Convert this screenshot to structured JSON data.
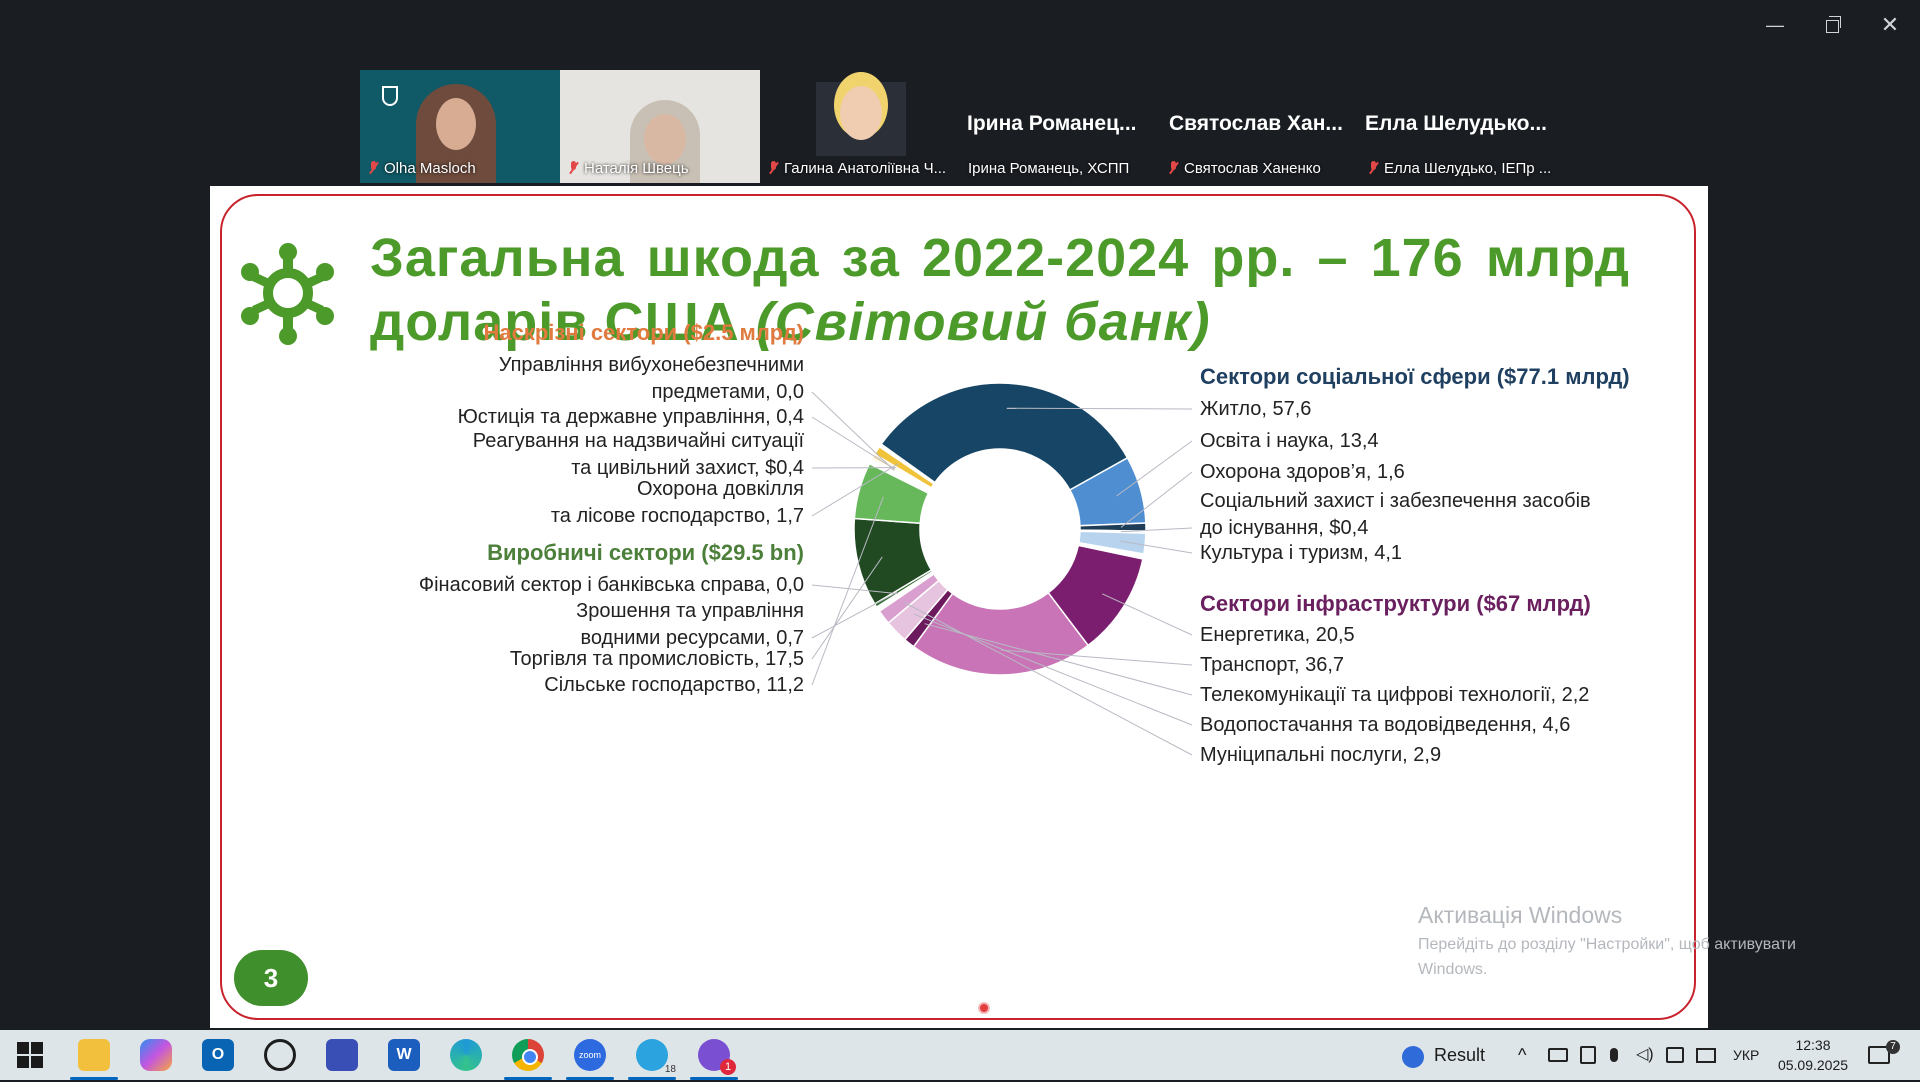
{
  "window": {
    "minimize": "—",
    "restore": "",
    "close": "✕"
  },
  "participants": [
    {
      "name": "Olha Masloch",
      "muted": true
    },
    {
      "name": "Наталія Швець",
      "muted": true
    },
    {
      "name": "Галина Анатоліївна Ч...",
      "muted": true
    },
    {
      "display": "Ірина Романец...",
      "name": "Ірина Романець, ХСПП",
      "muted": false
    },
    {
      "display": "Святослав Хан...",
      "name": "Святослав Ханенко",
      "muted": true
    },
    {
      "display": "Елла Шелудько...",
      "name": "Елла Шелудько, ІЕПр ...",
      "muted": true
    }
  ],
  "slide": {
    "title_line1": "Загальна шкода за 2022-2024 рр. – 176 млрд",
    "title_line2_plain": "доларів США ",
    "title_line2_italic": "(Світовий банк)",
    "page_number": "3",
    "colors": {
      "title": "#4c9a2a",
      "frame": "#c8232c",
      "cross": "#e07a3f",
      "productive": "#4c7f3a",
      "social": "#1f4060",
      "infra": "#6a1f5f"
    }
  },
  "chart_data": {
    "type": "pie",
    "title": "Загальна шкода за 2022-2024 рр. – 176 млрд доларів США (Світовий банк)",
    "groups": [
      {
        "name": "Наскрізні сектори ($2.5 млрд)",
        "items": [
          {
            "label_lines": [
              "Управління вибухонебезпечними",
              "предметами, 0,0"
            ],
            "value": 0.0
          },
          {
            "label_lines": [
              "Юстиція та державне управління, 0,4"
            ],
            "value": 0.4
          },
          {
            "label_lines": [
              "Реагування на надзвичайні ситуації",
              "та цивільний захист, $0,4"
            ],
            "value": 0.4
          },
          {
            "label_lines": [
              "Охорона довкілля",
              "та лісове господарство, 1,7"
            ],
            "value": 1.7
          }
        ]
      },
      {
        "name": "Виробничі сектори ($29.5 bn)",
        "items": [
          {
            "label_lines": [
              "Фінасовий сектор і банківська справа, 0,0"
            ],
            "value": 0.0
          },
          {
            "label_lines": [
              "Зрошення та управління",
              "водними ресурсами, 0,7"
            ],
            "value": 0.7
          },
          {
            "label_lines": [
              "Торгівля та промисловість, 17,5"
            ],
            "value": 17.5
          },
          {
            "label_lines": [
              "Сільське господарство, 11,2"
            ],
            "value": 11.2
          }
        ]
      },
      {
        "name": "Сектори соціальної сфери ($77.1 млрд)",
        "items": [
          {
            "label_lines": [
              "Житло, 57,6"
            ],
            "value": 57.6
          },
          {
            "label_lines": [
              "Освіта і наука, 13,4"
            ],
            "value": 13.4
          },
          {
            "label_lines": [
              "Охорона здоров’я, 1,6"
            ],
            "value": 1.6
          },
          {
            "label_lines": [
              "Соціальний захист і забезпечення засобів",
              "до існування, $0,4"
            ],
            "value": 0.4
          },
          {
            "label_lines": [
              "Культура і туризм, 4,1"
            ],
            "value": 4.1
          }
        ]
      },
      {
        "name": "Сектори інфраструктури  ($67 млрд)",
        "items": [
          {
            "label_lines": [
              "Енергетика, 20,5"
            ],
            "value": 20.5
          },
          {
            "label_lines": [
              "Транспорт, 36,7"
            ],
            "value": 36.7
          },
          {
            "label_lines": [
              "Телекомунікації та цифрові технології, 2,2"
            ],
            "value": 2.2
          },
          {
            "label_lines": [
              "Водопостачання та водовідведення, 4,6"
            ],
            "value": 4.6
          },
          {
            "label_lines": [
              "Муніципальні послуги, 2,9"
            ],
            "value": 2.9
          }
        ]
      }
    ]
  },
  "watermark": {
    "title": "Активація Windows",
    "line1": "Перейдіть до розділу \"Настройки\", щоб активувати",
    "line2": "Windows."
  },
  "taskbar": {
    "apps": [
      "start-icon",
      "file-explorer-icon",
      "copilot-icon",
      "outlook-icon",
      "whatsapp-icon",
      "save-app-icon",
      "word-icon",
      "edge-icon",
      "chrome-icon",
      "zoom-icon",
      "telegram-icon",
      "viber-icon"
    ],
    "telegram_badge": "18",
    "viber_badge": "1",
    "result_label": "Result",
    "language": "УКР",
    "time": "12:38",
    "date": "05.09.2025",
    "notifications": "7"
  }
}
